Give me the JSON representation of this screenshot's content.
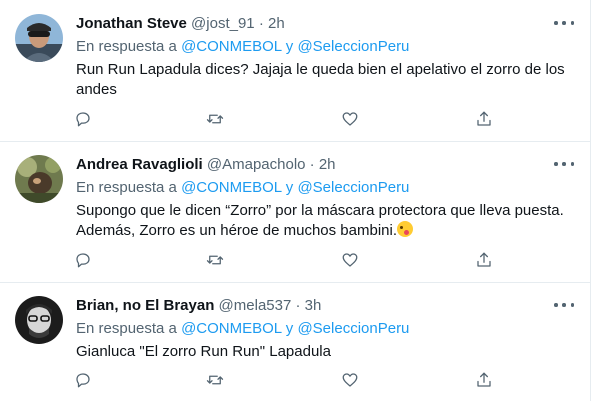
{
  "tweets": [
    {
      "name": "Jonathan Steve",
      "handle": "@jost_91",
      "separator": "·",
      "time": "2h",
      "reply_prefix": "En respuesta a",
      "reply_user1": "@CONMEBOL",
      "reply_and": "y",
      "reply_user2": "@SeleccionPeru",
      "text": "Run Run Lapadula dices? Jajaja le queda bien el apelativo el zorro de los andes"
    },
    {
      "name": "Andrea Ravaglioli",
      "handle": "@Amapacholo",
      "separator": "·",
      "time": "2h",
      "reply_prefix": "En respuesta a",
      "reply_user1": "@CONMEBOL",
      "reply_and": "y",
      "reply_user2": "@SeleccionPeru",
      "text_line1": "Supongo que le dicen “Zorro” por la máscara protectora que lleva puesta.",
      "text_line2": "Además, Zorro es un héroe de muchos bambini.",
      "emoji": "winking-face-with-tongue"
    },
    {
      "name": "Brian, no El Brayan",
      "handle": "@mela537",
      "separator": "·",
      "time": "3h",
      "reply_prefix": "En respuesta a",
      "reply_user1": "@CONMEBOL",
      "reply_and": "y",
      "reply_user2": "@SeleccionPeru",
      "text": "Gianluca \"El zorro Run Run\" Lapadula"
    }
  ],
  "icons": {
    "reply": "reply-icon",
    "retweet": "retweet-icon",
    "like": "heart-icon",
    "share": "share-icon",
    "more": "more-icon"
  },
  "colors": {
    "mention": "#1d9bf0",
    "secondary_text": "#536471",
    "primary_text": "#0f1419",
    "divider": "#e6ecf0"
  }
}
